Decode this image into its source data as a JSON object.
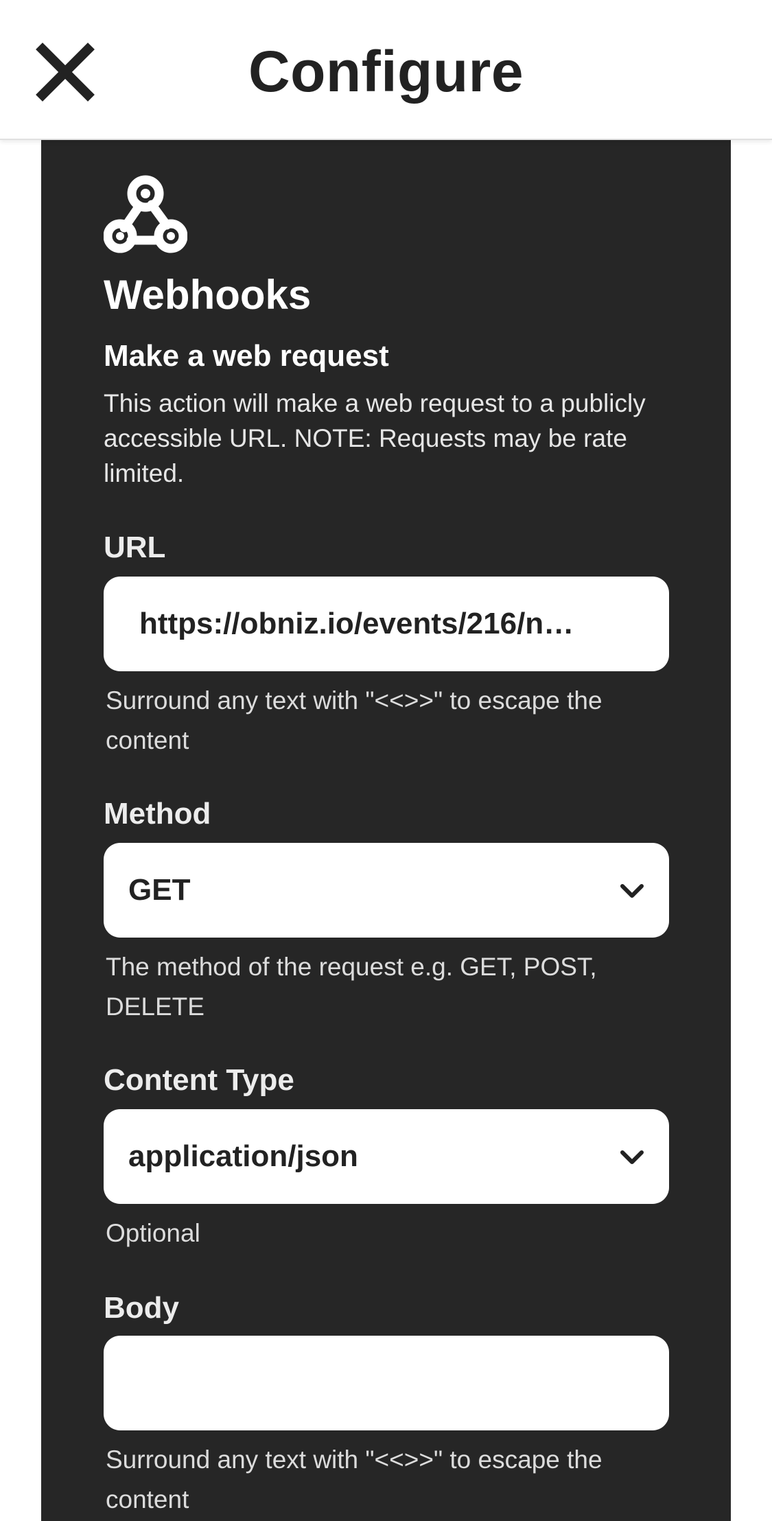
{
  "header": {
    "title": "Configure",
    "close_icon": "close-icon"
  },
  "service": {
    "icon": "webhooks-icon",
    "name": "Webhooks"
  },
  "action": {
    "title": "Make a web request",
    "description": "This action will make a web request to a publicly accessible URL. NOTE: Requests may be rate limited."
  },
  "fields": {
    "url": {
      "label": "URL",
      "value": "https://obniz.io/events/216/n…",
      "helper": "Surround any text with \"<<>>\" to escape the content"
    },
    "method": {
      "label": "Method",
      "value": "GET",
      "helper": "The method of the request e.g. GET, POST, DELETE"
    },
    "content_type": {
      "label": "Content Type",
      "value": "application/json",
      "helper": "Optional"
    },
    "body": {
      "label": "Body",
      "value": "",
      "helper": "Surround any text with \"<<>>\" to escape the content"
    }
  },
  "colors": {
    "card_background": "#262626",
    "header_background": "#ffffff",
    "field_background": "#ffffff",
    "title_text": "#222222"
  }
}
